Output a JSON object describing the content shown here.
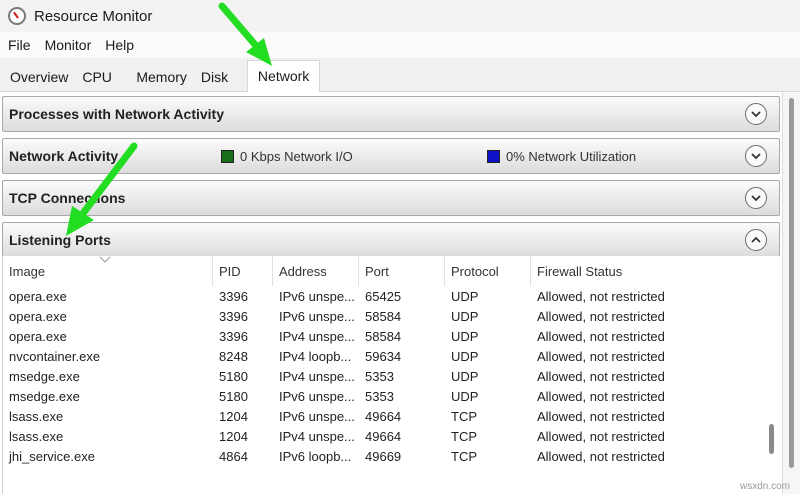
{
  "window": {
    "title": "Resource Monitor"
  },
  "menu": [
    "File",
    "Monitor",
    "Help"
  ],
  "tabs": [
    "Overview",
    "CPU",
    "Memory",
    "Disk",
    "Network"
  ],
  "sections": {
    "processes": {
      "title": "Processes with Network Activity"
    },
    "activity": {
      "title": "Network Activity",
      "io_label": "0 Kbps Network I/O",
      "util_label": "0% Network Utilization",
      "io_color": "#1a6e1a",
      "util_color": "#1010c8"
    },
    "tcp": {
      "title": "TCP Connections"
    },
    "listening": {
      "title": "Listening Ports"
    }
  },
  "table": {
    "columns": [
      "Image",
      "PID",
      "Address",
      "Port",
      "Protocol",
      "Firewall Status"
    ],
    "rows": [
      [
        "opera.exe",
        "3396",
        "IPv6 unspe...",
        "65425",
        "UDP",
        "Allowed, not restricted"
      ],
      [
        "opera.exe",
        "3396",
        "IPv6 unspe...",
        "58584",
        "UDP",
        "Allowed, not restricted"
      ],
      [
        "opera.exe",
        "3396",
        "IPv4 unspe...",
        "58584",
        "UDP",
        "Allowed, not restricted"
      ],
      [
        "nvcontainer.exe",
        "8248",
        "IPv4 loopb...",
        "59634",
        "UDP",
        "Allowed, not restricted"
      ],
      [
        "msedge.exe",
        "5180",
        "IPv4 unspe...",
        "5353",
        "UDP",
        "Allowed, not restricted"
      ],
      [
        "msedge.exe",
        "5180",
        "IPv6 unspe...",
        "5353",
        "UDP",
        "Allowed, not restricted"
      ],
      [
        "lsass.exe",
        "1204",
        "IPv6 unspe...",
        "49664",
        "TCP",
        "Allowed, not restricted"
      ],
      [
        "lsass.exe",
        "1204",
        "IPv4 unspe...",
        "49664",
        "TCP",
        "Allowed, not restricted"
      ],
      [
        "jhi_service.exe",
        "4864",
        "IPv6 loopb...",
        "49669",
        "TCP",
        "Allowed, not restricted"
      ]
    ]
  },
  "watermark": "wsxdn.com",
  "annotation_color": "#22dd22"
}
